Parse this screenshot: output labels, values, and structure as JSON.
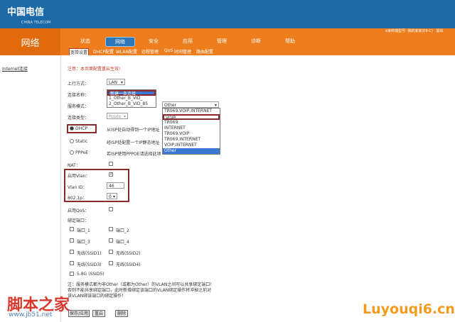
{
  "brand": {
    "logo": "中国电信",
    "logo_sub": "CHINA TELECOM"
  },
  "header": {
    "section_title": "网络",
    "device_info": "e家终端型号: 我的家家(E8-C)",
    "logout": "退出"
  },
  "nav_tabs": [
    "状态",
    "网络",
    "安全",
    "应用",
    "管理",
    "诊断",
    "帮助"
  ],
  "sub_nav": [
    "宽带设置",
    "DHCP配置",
    "WLAN配置",
    "远程管理",
    "QoS",
    "时间管理",
    "路由配置"
  ],
  "sidebar": {
    "items": [
      "Internet连接"
    ]
  },
  "form": {
    "notice": "注意：本页面配置重启生效!",
    "uplink_label": "上行方式：",
    "uplink_value": "LAN",
    "conn_name_label": "连接名称：",
    "conn_name_options": [
      "新建一条连接",
      "1_Other_B_VID_",
      "2_Other_B_VID_85"
    ],
    "service_mode_label": "服务模式：",
    "service_mode_value": "Other",
    "service_options": [
      "TR069,VOIP,INTERNET",
      "VOIP",
      "TR069",
      "INTERNET",
      "TR069,VOIP",
      "TR069,INTERNET",
      "VOIP,INTERNET",
      "Other"
    ],
    "conn_type_label": "连接类型：",
    "conn_type_value": "Route",
    "dhcp_label": "DHCP",
    "dhcp_desc": "从ISP处自动得到一个IP地址",
    "static_label": "Static",
    "static_desc": "经ISP处配置一个IP静态地址",
    "pppoe_label": "PPPoE",
    "pppoe_desc": "若ISP使用PPPOE请选择此项",
    "nat_label": "NAT：",
    "vlan_enable_label": "启用Vlan：",
    "vlan_id_label": "Vlan ID：",
    "vlan_id_value": "46",
    "dot1p_label": "802.1p：",
    "dot1p_value": "0",
    "qos_label": "启用QoS：",
    "bind_port_label": "绑定端口：",
    "ports": [
      "端口_1",
      "端口_2",
      "端口_3",
      "端口_4",
      "无线(SSID1)",
      "无线(SSID2)",
      "无线(SSID3)",
      "无线(SSID4)",
      "5.8G (SSID5)"
    ],
    "footnote_1": "注：服务模式都为非Other（或都为Other）的VLAN之间可以共享绑定端口！",
    "footnote_2": "否则不能共享绑定端口，此时新增绑定该端口的VLAN绑定操作将冲掉之前对",
    "footnote_3": "该VLAN绑该端口的绑定操作！",
    "buttons": {
      "save": "保存/应用",
      "reset": "重启",
      "delete": "删除"
    }
  },
  "watermarks": {
    "left": "脚本之家",
    "left_url": "www.jb51.net",
    "right": "Luyouqi6.cn"
  },
  "colors": {
    "nav_orange": "#ee7e1d",
    "header_blue": "#1c6ba8",
    "highlight": "#3a78d4",
    "annotation_red": "#8b2a2a"
  }
}
